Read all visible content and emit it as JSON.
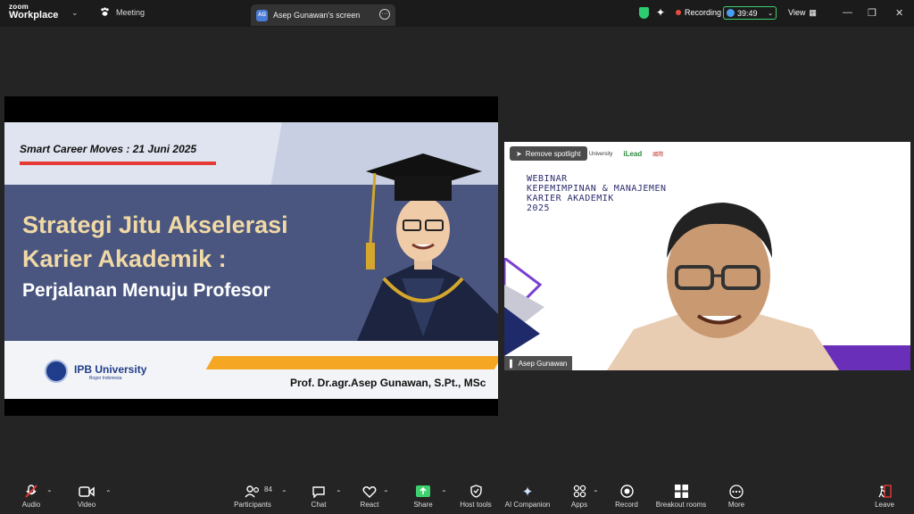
{
  "titlebar": {
    "brand_top": "zoom",
    "brand_bottom": "Workplace",
    "meeting_label": "Meeting",
    "screen_tab_initials": "AG",
    "screen_tab_label": "Asep Gunawan's screen",
    "recording_label": "Recording",
    "timer": "39:49",
    "view_label": "View"
  },
  "slide": {
    "date_line": "Smart Career Moves : 21 Juni 2025",
    "title_line1": "Strategi Jitu Akselerasi",
    "title_line2": "Karier Akademik :",
    "subtitle": "Perjalanan Menuju Profesor",
    "institution": "IPB University",
    "institution_sub": "Bogor Indonesia",
    "author": "Prof. Dr.agr.Asep Gunawan, S.Pt., MSc"
  },
  "camera": {
    "spotlight_label": "Remove spotlight",
    "logo1": "University",
    "logo2": "iLead",
    "logo3": "國際",
    "webinar_lines": [
      "WEBINAR",
      "KEPEMIMPINAN & MANAJEMEN",
      "KARIER AKADEMIK",
      "2025"
    ],
    "participant_name": "Asep Gunawan"
  },
  "toolbar": {
    "audio": "Audio",
    "video": "Video",
    "participants": "Participants",
    "participant_count": "84",
    "chat": "Chat",
    "react": "React",
    "share": "Share",
    "host_tools": "Host tools",
    "ai_companion": "AI Companion",
    "apps": "Apps",
    "record": "Record",
    "breakout_rooms": "Breakout rooms",
    "more": "More",
    "leave": "Leave"
  },
  "colors": {
    "background": "#242424",
    "share_accent": "#3ecf6e",
    "slide_navy": "#4a5680",
    "slide_gold": "#f1d9a6",
    "record_red": "#e74c3c"
  }
}
